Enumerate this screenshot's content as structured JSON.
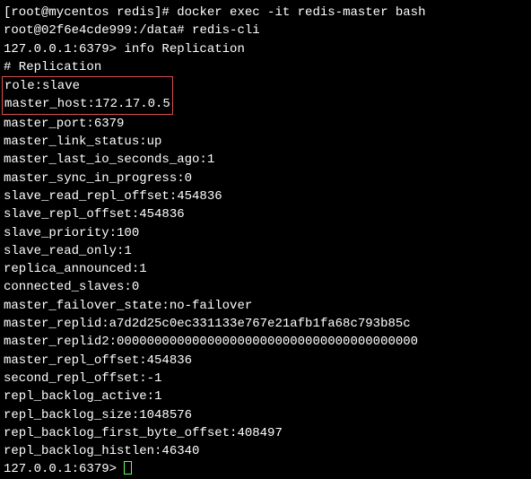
{
  "prompt1": {
    "prefix": "[root@mycentos redis]# ",
    "command": "docker exec -it redis-master bash"
  },
  "prompt2": {
    "prefix": "root@02f6e4cde999:/data# ",
    "command": "redis-cli"
  },
  "prompt3": {
    "prefix": "127.0.0.1:6379> ",
    "command": "info Replication"
  },
  "header": "# Replication",
  "boxed": {
    "role": "role:slave",
    "master_host": "master_host:172.17.0.5"
  },
  "lines": [
    "master_port:6379",
    "master_link_status:up",
    "master_last_io_seconds_ago:1",
    "master_sync_in_progress:0",
    "slave_read_repl_offset:454836",
    "slave_repl_offset:454836",
    "slave_priority:100",
    "slave_read_only:1",
    "replica_announced:1",
    "connected_slaves:0",
    "master_failover_state:no-failover",
    "master_replid:a7d2d25c0ec331133e767e21afb1fa68c793b85c",
    "master_replid2:0000000000000000000000000000000000000000",
    "master_repl_offset:454836",
    "second_repl_offset:-1",
    "repl_backlog_active:1",
    "repl_backlog_size:1048576",
    "repl_backlog_first_byte_offset:408497",
    "repl_backlog_histlen:46340"
  ],
  "prompt4": {
    "prefix": "127.0.0.1:6379> "
  }
}
